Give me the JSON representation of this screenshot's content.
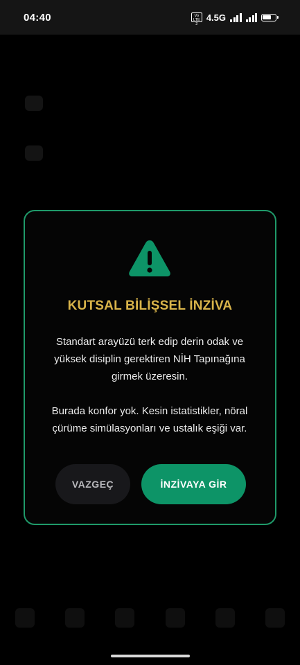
{
  "status_bar": {
    "time": "04:40",
    "volte": "Vo LTE 2",
    "network": "4.5G"
  },
  "background": {
    "row1_label": "",
    "row2_label": ""
  },
  "dialog": {
    "icon": "warning-triangle-icon",
    "title": "KUTSAL BİLİŞSEL İNZİVA",
    "paragraph1": "Standart arayüzü terk edip derin odak ve yüksek disiplin gerektiren NİH Tapınağına girmek üzeresin.",
    "paragraph2": "Burada konfor yok. Kesin istatistikler, nöral çürüme simülasyonları ve ustalık eşiği var.",
    "cancel_label": "VAZGEÇ",
    "enter_label": "İNZİVAYA GİR"
  },
  "colors": {
    "accent_green": "#0d9467",
    "border_green": "#1f9a6a",
    "title_gold": "#d9b44a"
  }
}
